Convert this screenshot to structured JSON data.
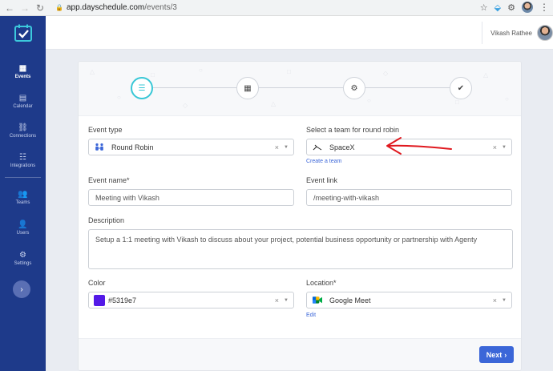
{
  "browser": {
    "url_host": "app.dayschedule.com",
    "url_path": "/events/3"
  },
  "sidebar": {
    "items": [
      {
        "label": "Events",
        "icon": "calendar-icon",
        "active": true
      },
      {
        "label": "Calendar",
        "icon": "calendar-day-icon",
        "active": false
      },
      {
        "label": "Connections",
        "icon": "link-icon",
        "active": false
      },
      {
        "label": "Integrations",
        "icon": "grid-icon",
        "active": false
      },
      {
        "label": "Teams",
        "icon": "users-icon",
        "active": false
      },
      {
        "label": "Users",
        "icon": "user-group-icon",
        "active": false
      },
      {
        "label": "Settings",
        "icon": "gear-icon",
        "active": false
      }
    ],
    "collapse_glyph": "›"
  },
  "header": {
    "user_name": "Vikash Rathee"
  },
  "form": {
    "event_type": {
      "label": "Event type",
      "value": "Round Robin"
    },
    "team": {
      "label": "Select a team for round robin",
      "value": "SpaceX",
      "link": "Create a team"
    },
    "event_name": {
      "label": "Event name*",
      "placeholder": "Meeting with Vikash"
    },
    "event_link": {
      "label": "Event link",
      "placeholder": "/meeting-with-vikash"
    },
    "description": {
      "label": "Description",
      "placeholder": "Setup a 1:1 meeting with Vikash to discuss about your project, potential business opportunity or partnership with Agenty"
    },
    "color": {
      "label": "Color",
      "value": "#5319e7"
    },
    "location": {
      "label": "Location*",
      "value": "Google Meet",
      "link": "Edit"
    }
  },
  "actions": {
    "next_label": "Next"
  },
  "theme": {
    "sidebar_bg": "#1e3a8a",
    "accent": "#3b66d8",
    "stepper_active": "#38c7d6",
    "annotation": "#e0191f"
  }
}
